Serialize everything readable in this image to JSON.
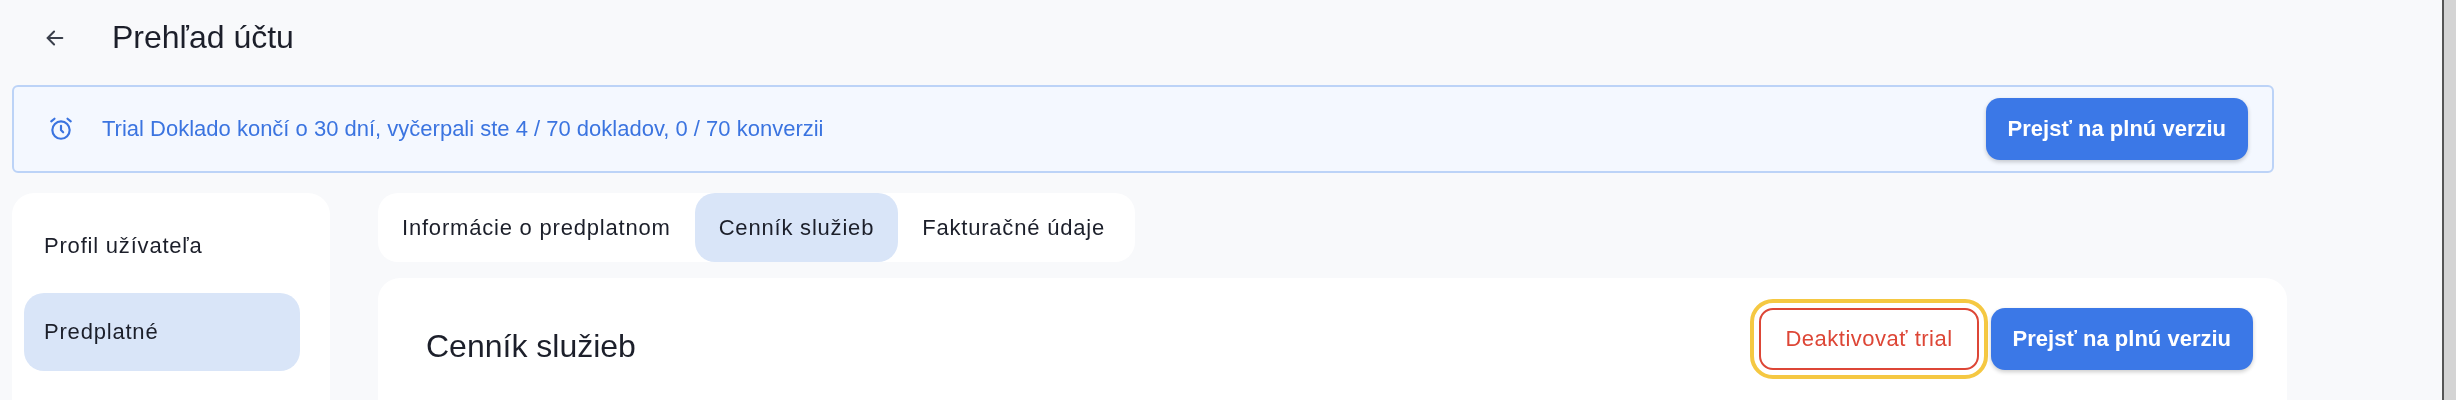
{
  "header": {
    "title": "Prehľad účtu"
  },
  "banner": {
    "message": "Trial Doklado končí o 30 dní, vyčerpali ste 4 / 70 dokladov, 0 / 70 konverzii",
    "button": "Prejsť na plnú verziu"
  },
  "sidebar": {
    "items": [
      {
        "label": "Profil užívateľa",
        "selected": false
      },
      {
        "label": "Predplatné",
        "selected": true
      }
    ]
  },
  "tabs": [
    {
      "label": "Informácie o predplatnom",
      "selected": false
    },
    {
      "label": "Cenník služieb",
      "selected": true
    },
    {
      "label": "Fakturačné údaje",
      "selected": false
    }
  ],
  "card": {
    "title": "Cenník služieb",
    "buttons": [
      {
        "label": "Deaktivovať trial",
        "kind": "outline",
        "focused": true
      },
      {
        "label": "Prejsť na plnú verziu",
        "kind": "primary",
        "focused": false
      }
    ]
  }
}
